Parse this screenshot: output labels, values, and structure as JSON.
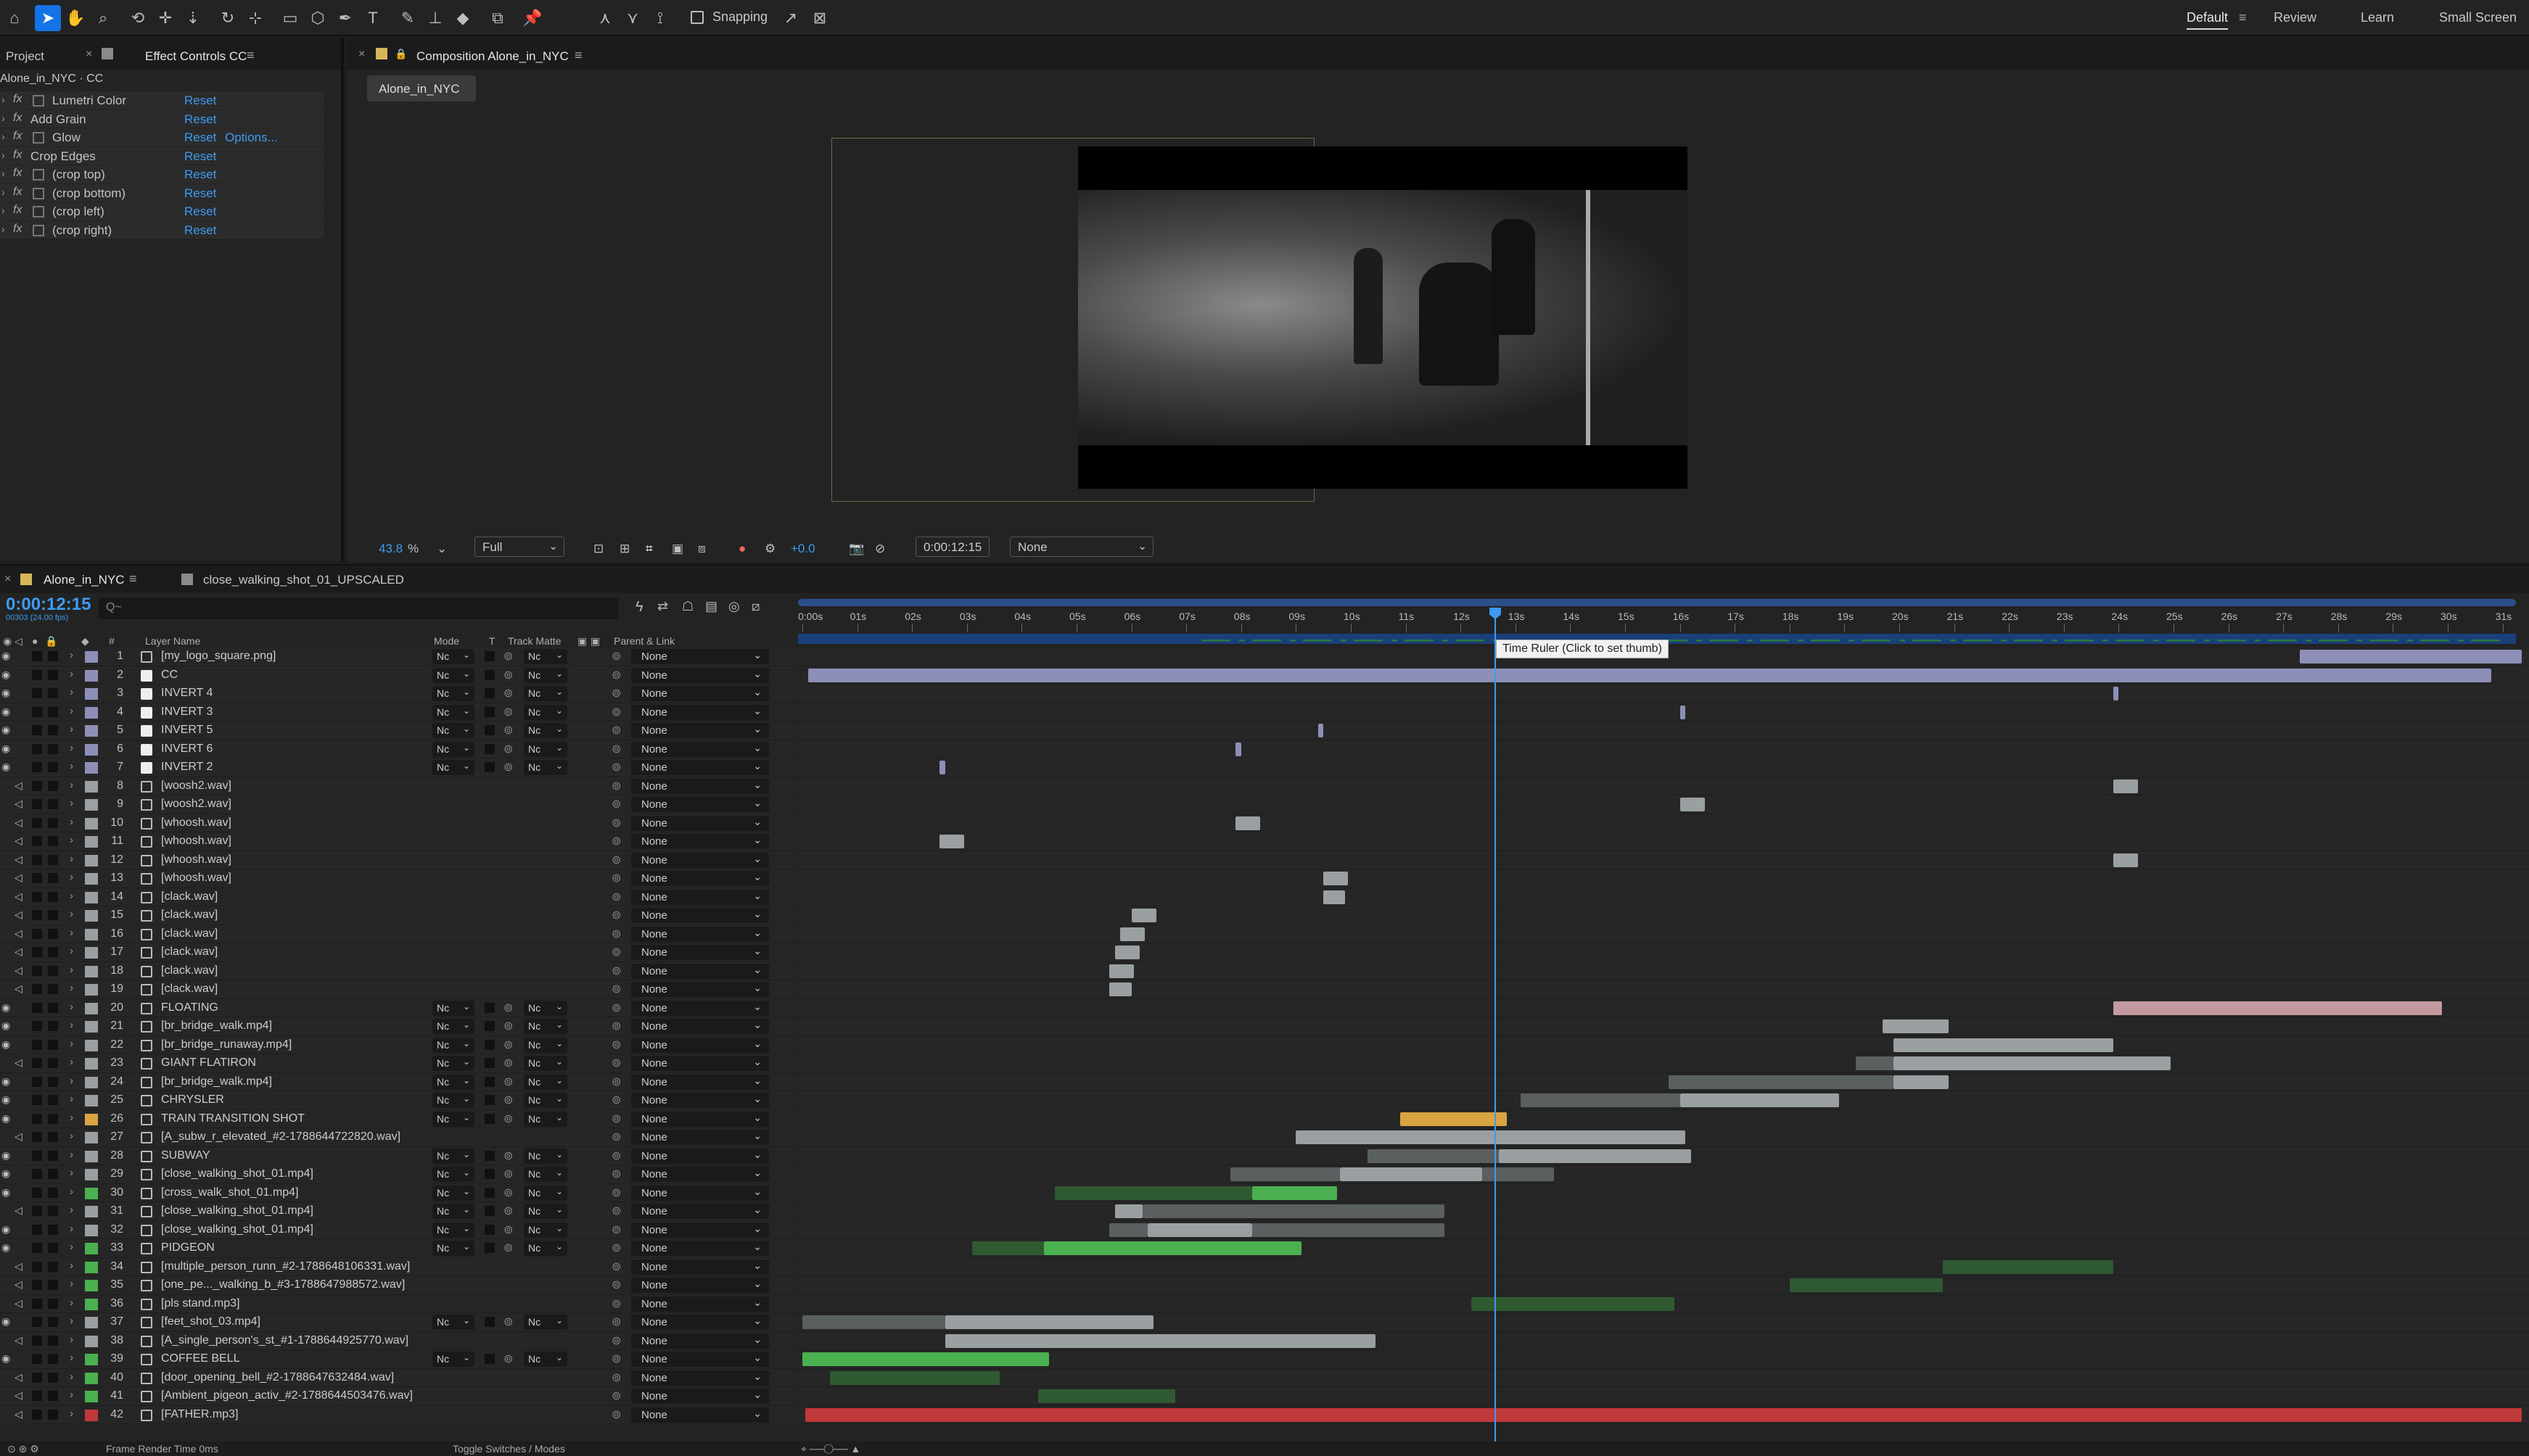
{
  "toolbar": {
    "tools": [
      "home-icon",
      "selection-icon",
      "hand-icon",
      "zoom-icon",
      "orbit-icon",
      "pan-icon",
      "dolly-icon",
      "rotate-icon",
      "anchor-icon",
      "rectangle-icon",
      "pen-icon",
      "type-icon",
      "brush-icon",
      "clone-stamp-icon",
      "eraser-icon",
      "roto-brush-icon",
      "puppet-icon"
    ],
    "snapping_label": "Snapping",
    "workspaces": [
      "Default",
      "Review",
      "Learn",
      "Small Screen"
    ]
  },
  "project_panel": {
    "tabs": [
      "Project",
      "Effect Controls CC"
    ],
    "header": "Alone_in_NYC · CC",
    "effects": [
      {
        "name": "Lumetri Color",
        "reset": "Reset",
        "icon": true
      },
      {
        "name": "Add Grain",
        "reset": "Reset",
        "icon": false
      },
      {
        "name": "Glow",
        "reset": "Reset",
        "options": "Options...",
        "icon": true
      },
      {
        "name": "Crop Edges",
        "reset": "Reset",
        "icon": false
      },
      {
        "name": "(crop top)",
        "reset": "Reset",
        "icon": true
      },
      {
        "name": "(crop bottom)",
        "reset": "Reset",
        "icon": true
      },
      {
        "name": "(crop left)",
        "reset": "Reset",
        "icon": true
      },
      {
        "name": "(crop right)",
        "reset": "Reset",
        "icon": true
      }
    ]
  },
  "composition_panel": {
    "tab": "Composition Alone_in_NYC",
    "comp_chip": "Alone_in_NYC",
    "zoom": "43.8",
    "zoom_unit": "%",
    "resolution": "Full",
    "exposure": "+0.0",
    "timecode": "0:00:12:15",
    "view_option": "None"
  },
  "timeline": {
    "tabs": [
      "Alone_in_NYC",
      "close_walking_shot_01_UPSCALED"
    ],
    "current_time": "0:00:12:15",
    "fps_note": "00303 (24.00 fps)",
    "search_placeholder": "Q~",
    "columns": {
      "layer_name": "Layer Name",
      "mode": "Mode",
      "t": "T",
      "track_matte": "Track Matte",
      "parent": "Parent & Link"
    },
    "ruler": [
      "0:00s",
      "01s",
      "02s",
      "03s",
      "04s",
      "05s",
      "06s",
      "07s",
      "08s",
      "09s",
      "10s",
      "11s",
      "12s",
      "13s",
      "14s",
      "15s",
      "16s",
      "17s",
      "18s",
      "19s",
      "20s",
      "21s",
      "22s",
      "23s",
      "24s",
      "25s",
      "26s",
      "27s",
      "28s",
      "29s",
      "30s",
      "31s"
    ],
    "tooltip": "Time Ruler (Click to set thumb)",
    "mode_value": "Nc",
    "matte_value": "Nc",
    "parent_value": "None",
    "layers": [
      {
        "n": 1,
        "name": "[my_logo_square.png]",
        "label": "#8d8fb8",
        "vid": true,
        "sw": true,
        "solid": false
      },
      {
        "n": 2,
        "name": "CC",
        "label": "#8d8fb8",
        "vid": true,
        "sw": true,
        "solid": true
      },
      {
        "n": 3,
        "name": "INVERT 4",
        "label": "#8d8fb8",
        "vid": true,
        "sw": true,
        "solid": true
      },
      {
        "n": 4,
        "name": "INVERT 3",
        "label": "#8d8fb8",
        "vid": true,
        "sw": true,
        "solid": true
      },
      {
        "n": 5,
        "name": "INVERT 5",
        "label": "#8d8fb8",
        "vid": true,
        "sw": true,
        "solid": true
      },
      {
        "n": 6,
        "name": "INVERT 6",
        "label": "#8d8fb8",
        "vid": true,
        "sw": true,
        "solid": true
      },
      {
        "n": 7,
        "name": "INVERT 2",
        "label": "#8d8fb8",
        "vid": true,
        "sw": true,
        "solid": true
      },
      {
        "n": 8,
        "name": "[woosh2.wav]",
        "label": "#9aa0a2",
        "vid": false,
        "sw": false,
        "solid": false
      },
      {
        "n": 9,
        "name": "[woosh2.wav]",
        "label": "#9aa0a2",
        "vid": false,
        "sw": false,
        "solid": false
      },
      {
        "n": 10,
        "name": "[whoosh.wav]",
        "label": "#9aa0a2",
        "vid": false,
        "sw": false,
        "solid": false
      },
      {
        "n": 11,
        "name": "[whoosh.wav]",
        "label": "#9aa0a2",
        "vid": false,
        "sw": false,
        "solid": false
      },
      {
        "n": 12,
        "name": "[whoosh.wav]",
        "label": "#9aa0a2",
        "vid": false,
        "sw": false,
        "solid": false
      },
      {
        "n": 13,
        "name": "[whoosh.wav]",
        "label": "#9aa0a2",
        "vid": false,
        "sw": false,
        "solid": false
      },
      {
        "n": 14,
        "name": "[clack.wav]",
        "label": "#9aa0a2",
        "vid": false,
        "sw": false,
        "solid": false
      },
      {
        "n": 15,
        "name": "[clack.wav]",
        "label": "#9aa0a2",
        "vid": false,
        "sw": false,
        "solid": false
      },
      {
        "n": 16,
        "name": "[clack.wav]",
        "label": "#9aa0a2",
        "vid": false,
        "sw": false,
        "solid": false
      },
      {
        "n": 17,
        "name": "[clack.wav]",
        "label": "#9aa0a2",
        "vid": false,
        "sw": false,
        "solid": false
      },
      {
        "n": 18,
        "name": "[clack.wav]",
        "label": "#9aa0a2",
        "vid": false,
        "sw": false,
        "solid": false
      },
      {
        "n": 19,
        "name": "[clack.wav]",
        "label": "#9aa0a2",
        "vid": false,
        "sw": false,
        "solid": false
      },
      {
        "n": 20,
        "name": "FLOATING",
        "label": "#9aa0a2",
        "vid": true,
        "sw": true,
        "solid": false
      },
      {
        "n": 21,
        "name": "[br_bridge_walk.mp4]",
        "label": "#9aa0a2",
        "vid": true,
        "sw": true,
        "solid": false
      },
      {
        "n": 22,
        "name": "[br_bridge_runaway.mp4]",
        "label": "#9aa0a2",
        "vid": true,
        "sw": true,
        "solid": false
      },
      {
        "n": 23,
        "name": "GIANT FLATIRON",
        "label": "#9aa0a2",
        "vid": false,
        "sw": true,
        "solid": false
      },
      {
        "n": 24,
        "name": "[br_bridge_walk.mp4]",
        "label": "#9aa0a2",
        "vid": true,
        "sw": true,
        "solid": false
      },
      {
        "n": 25,
        "name": "CHRYSLER",
        "label": "#9aa0a2",
        "vid": true,
        "sw": true,
        "solid": false
      },
      {
        "n": 26,
        "name": "TRAIN TRANSITION SHOT",
        "label": "#d9a441",
        "vid": true,
        "sw": true,
        "solid": false
      },
      {
        "n": 27,
        "name": "[A_subw_r_elevated_#2-1788644722820.wav]",
        "label": "#9aa0a2",
        "vid": false,
        "sw": false,
        "solid": false
      },
      {
        "n": 28,
        "name": "SUBWAY",
        "label": "#9aa0a2",
        "vid": true,
        "sw": true,
        "solid": false
      },
      {
        "n": 29,
        "name": "[close_walking_shot_01.mp4]",
        "label": "#9aa0a2",
        "vid": true,
        "sw": true,
        "solid": false
      },
      {
        "n": 30,
        "name": "[cross_walk_shot_01.mp4]",
        "label": "#4bb04f",
        "vid": true,
        "sw": true,
        "solid": false
      },
      {
        "n": 31,
        "name": "[close_walking_shot_01.mp4]",
        "label": "#9aa0a2",
        "vid": false,
        "sw": true,
        "solid": false
      },
      {
        "n": 32,
        "name": "[close_walking_shot_01.mp4]",
        "label": "#9aa0a2",
        "vid": true,
        "sw": true,
        "solid": false
      },
      {
        "n": 33,
        "name": "PIDGEON",
        "label": "#4bb04f",
        "vid": true,
        "sw": true,
        "solid": false
      },
      {
        "n": 34,
        "name": "[multiple_person_runn_#2-1788648106331.wav]",
        "label": "#4bb04f",
        "vid": false,
        "sw": false,
        "solid": false
      },
      {
        "n": 35,
        "name": "[one_pe..._walking_b_#3-1788647988572.wav]",
        "label": "#4bb04f",
        "vid": false,
        "sw": false,
        "solid": false
      },
      {
        "n": 36,
        "name": "[pls stand.mp3]",
        "label": "#4bb04f",
        "vid": false,
        "sw": false,
        "solid": false
      },
      {
        "n": 37,
        "name": "[feet_shot_03.mp4]",
        "label": "#9aa0a2",
        "vid": true,
        "sw": true,
        "solid": false
      },
      {
        "n": 38,
        "name": "[A_single_person's_st_#1-1788644925770.wav]",
        "label": "#9aa0a2",
        "vid": false,
        "sw": false,
        "solid": false
      },
      {
        "n": 39,
        "name": "COFFEE BELL",
        "label": "#4bb04f",
        "vid": true,
        "sw": true,
        "solid": false
      },
      {
        "n": 40,
        "name": "[door_opening_bell_#2-1788647632484.wav]",
        "label": "#4bb04f",
        "vid": false,
        "sw": false,
        "solid": false
      },
      {
        "n": 41,
        "name": "[Ambient_pigeon_activ_#2-1788644503476.wav]",
        "label": "#4bb04f",
        "vid": false,
        "sw": false,
        "solid": false
      },
      {
        "n": 42,
        "name": "[FATHER.mp3]",
        "label": "#c0393b",
        "vid": false,
        "sw": false,
        "solid": false
      }
    ],
    "bars": [
      [
        {
          "s": 27.3,
          "e": 31.35,
          "c": "#8d8fb8"
        }
      ],
      [
        {
          "s": 0.1,
          "e": 30.8,
          "c": "#8d8fb8"
        }
      ],
      [
        {
          "s": 23.9,
          "e": 24.0,
          "c": "#8d8fb8"
        }
      ],
      [
        {
          "s": 16.0,
          "e": 16.1,
          "c": "#8d8fb8"
        }
      ],
      [
        {
          "s": 9.4,
          "e": 9.5,
          "c": "#8d8fb8"
        }
      ],
      [
        {
          "s": 7.9,
          "e": 8.0,
          "c": "#8d8fb8"
        }
      ],
      [
        {
          "s": 2.5,
          "e": 2.6,
          "c": "#8d8fb8"
        }
      ],
      [
        {
          "s": 23.9,
          "e": 24.35,
          "c": "#9aa0a2"
        }
      ],
      [
        {
          "s": 16.0,
          "e": 16.45,
          "c": "#9aa0a2"
        }
      ],
      [
        {
          "s": 7.9,
          "e": 8.35,
          "c": "#9aa0a2"
        }
      ],
      [
        {
          "s": 2.5,
          "e": 2.95,
          "c": "#9aa0a2"
        }
      ],
      [
        {
          "s": 23.9,
          "e": 24.35,
          "c": "#9aa0a2"
        }
      ],
      [
        {
          "s": 9.5,
          "e": 9.95,
          "c": "#9aa0a2"
        }
      ],
      [
        {
          "s": 9.5,
          "e": 9.9,
          "c": "#9aa0a2"
        }
      ],
      [
        {
          "s": 6.0,
          "e": 6.45,
          "c": "#9aa0a2"
        }
      ],
      [
        {
          "s": 5.8,
          "e": 6.25,
          "c": "#9aa0a2"
        }
      ],
      [
        {
          "s": 5.7,
          "e": 6.15,
          "c": "#9aa0a2"
        }
      ],
      [
        {
          "s": 5.6,
          "e": 6.05,
          "c": "#9aa0a2"
        }
      ],
      [
        {
          "s": 5.6,
          "e": 6.0,
          "c": "#9aa0a2"
        }
      ],
      [
        {
          "s": 23.9,
          "e": 29.9,
          "c": "#c49aa1"
        }
      ],
      [
        {
          "s": 19.7,
          "e": 20.9,
          "c": "#9aa0a2"
        }
      ],
      [
        {
          "s": 19.9,
          "e": 23.9,
          "c": "#9aa0a2"
        }
      ],
      [
        {
          "s": 19.2,
          "e": 19.9,
          "c": "#5a5f60"
        },
        {
          "s": 19.9,
          "e": 24.95,
          "c": "#9aa0a2"
        }
      ],
      [
        {
          "s": 15.8,
          "e": 19.9,
          "c": "#5a5f60"
        },
        {
          "s": 19.9,
          "e": 20.9,
          "c": "#9aa0a2"
        }
      ],
      [
        {
          "s": 13.1,
          "e": 16.0,
          "c": "#5a5f60"
        },
        {
          "s": 16.0,
          "e": 18.9,
          "c": "#9aa0a2"
        }
      ],
      [
        {
          "s": 10.9,
          "e": 12.85,
          "c": "#d9a441"
        }
      ],
      [
        {
          "s": 9.0,
          "e": 16.1,
          "c": "#9aa0a2"
        }
      ],
      [
        {
          "s": 10.3,
          "e": 12.7,
          "c": "#5a5f60"
        },
        {
          "s": 12.7,
          "e": 16.2,
          "c": "#9aa0a2"
        }
      ],
      [
        {
          "s": 7.8,
          "e": 9.8,
          "c": "#5a5f60"
        },
        {
          "s": 9.8,
          "e": 12.4,
          "c": "#9aa0a2"
        },
        {
          "s": 12.4,
          "e": 13.7,
          "c": "#5a5f60"
        }
      ],
      [
        {
          "s": 4.6,
          "e": 8.2,
          "c": "#2f5a31"
        },
        {
          "s": 8.2,
          "e": 9.75,
          "c": "#4bb04f"
        }
      ],
      [
        {
          "s": 5.7,
          "e": 6.2,
          "c": "#9aa0a2"
        },
        {
          "s": 6.2,
          "e": 11.7,
          "c": "#5a5f60"
        }
      ],
      [
        {
          "s": 5.6,
          "e": 6.3,
          "c": "#5a5f60"
        },
        {
          "s": 6.3,
          "e": 8.2,
          "c": "#9aa0a2"
        },
        {
          "s": 8.2,
          "e": 11.7,
          "c": "#5a5f60"
        }
      ],
      [
        {
          "s": 3.1,
          "e": 4.4,
          "c": "#2f5a31"
        },
        {
          "s": 4.4,
          "e": 9.1,
          "c": "#4bb04f"
        }
      ],
      [
        {
          "s": 20.8,
          "e": 23.9,
          "c": "#2f5a31"
        }
      ],
      [
        {
          "s": 18.0,
          "e": 20.8,
          "c": "#2f5a31"
        }
      ],
      [
        {
          "s": 12.2,
          "e": 15.9,
          "c": "#2f5a31"
        }
      ],
      [
        {
          "s": 0.0,
          "e": 2.6,
          "c": "#5a5f60"
        },
        {
          "s": 2.6,
          "e": 6.4,
          "c": "#9aa0a2"
        }
      ],
      [
        {
          "s": 2.6,
          "e": 10.45,
          "c": "#9aa0a2"
        }
      ],
      [
        {
          "s": 0.0,
          "e": 4.5,
          "c": "#4bb04f"
        }
      ],
      [
        {
          "s": 0.5,
          "e": 3.6,
          "c": "#2f5a31"
        }
      ],
      [
        {
          "s": 4.3,
          "e": 6.8,
          "c": "#2f5a31"
        }
      ],
      [
        {
          "s": 0.05,
          "e": 31.35,
          "c": "#c0393b"
        }
      ]
    ],
    "status_left": "Frame Render Time  0ms",
    "status_mid": "Toggle Switches / Modes"
  }
}
